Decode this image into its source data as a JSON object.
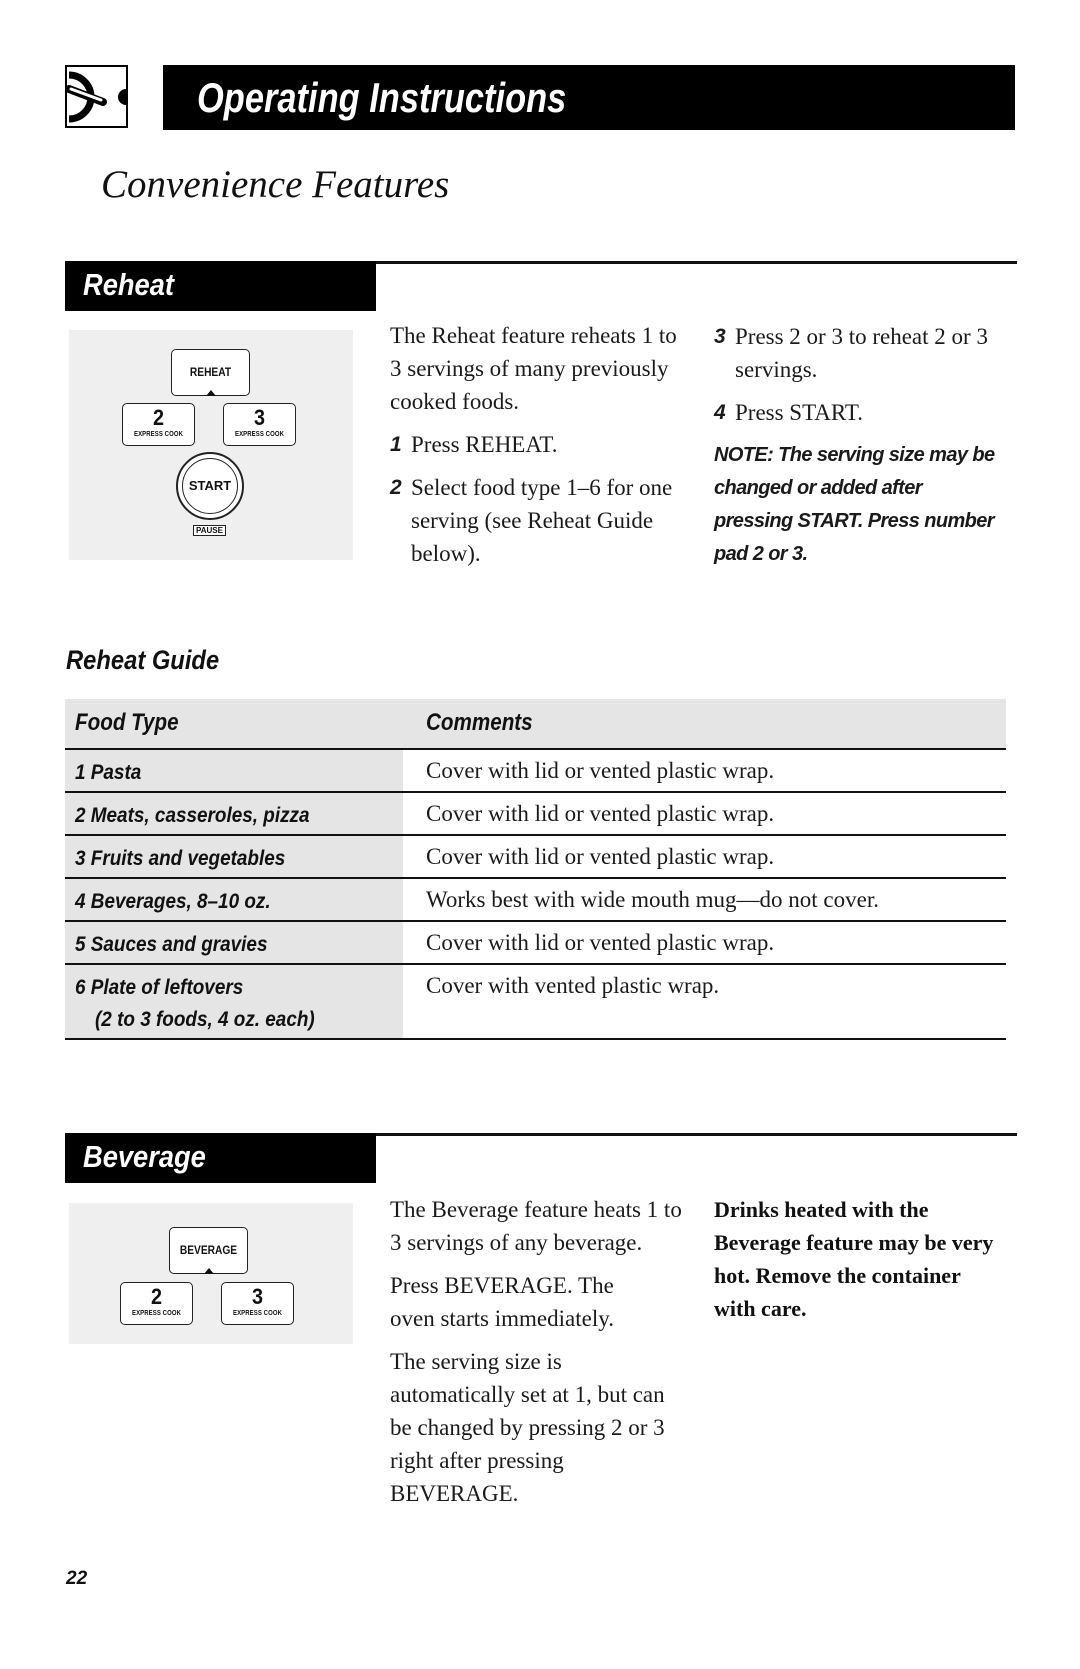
{
  "header": {
    "section_title": "Operating Instructions",
    "icon": "dial-control-icon",
    "subtitle": "Convenience Features"
  },
  "reheat": {
    "heading": "Reheat",
    "keypad": {
      "main_key": "REHEAT",
      "key2_number": "2",
      "key2_label": "EXPRESS COOK",
      "key3_number": "3",
      "key3_label": "EXPRESS COOK",
      "start_label": "START",
      "pause_label": "PAUSE"
    },
    "intro": "The Reheat feature reheats 1 to 3 servings of many previously cooked foods.",
    "steps": [
      {
        "num": "1",
        "text": "Press REHEAT."
      },
      {
        "num": "2",
        "text": "Select food type 1–6 for one serving (see Reheat Guide below)."
      },
      {
        "num": "3",
        "text": "Press 2 or 3 to reheat 2 or 3 servings."
      },
      {
        "num": "4",
        "text": "Press START."
      }
    ],
    "note": "NOTE: The serving size may be changed or added after pressing START. Press number pad 2 or 3."
  },
  "guide": {
    "title": "Reheat Guide",
    "columns": [
      "Food Type",
      "Comments"
    ],
    "rows": [
      {
        "food": "1 Pasta",
        "food_sub": "",
        "comment": "Cover with lid or vented plastic wrap."
      },
      {
        "food": "2 Meats, casseroles, pizza",
        "food_sub": "",
        "comment": "Cover with lid or vented plastic wrap."
      },
      {
        "food": "3 Fruits and vegetables",
        "food_sub": "",
        "comment": "Cover with lid or vented plastic wrap."
      },
      {
        "food": "4 Beverages, 8–10 oz.",
        "food_sub": "",
        "comment": "Works best with wide mouth mug—do not cover."
      },
      {
        "food": "5 Sauces and gravies",
        "food_sub": "",
        "comment": "Cover with lid or vented plastic wrap."
      },
      {
        "food": "6 Plate of leftovers",
        "food_sub": "(2 to 3 foods, 4 oz. each)",
        "comment": "Cover with vented plastic wrap."
      }
    ]
  },
  "beverage": {
    "heading": "Beverage",
    "keypad": {
      "main_key": "BEVERAGE",
      "key2_number": "2",
      "key2_label": "EXPRESS COOK",
      "key3_number": "3",
      "key3_label": "EXPRESS COOK"
    },
    "paragraphs": [
      "The Beverage feature heats 1 to 3 servings of any beverage.",
      "Press BEVERAGE. The oven starts immediately.",
      "The serving size is automatically set at 1, but can be changed by pressing 2 or 3 right after pressing BEVERAGE."
    ],
    "warning": "Drinks heated with the Beverage feature may be very hot. Remove the container with care."
  },
  "footer": {
    "page_number": "22"
  }
}
